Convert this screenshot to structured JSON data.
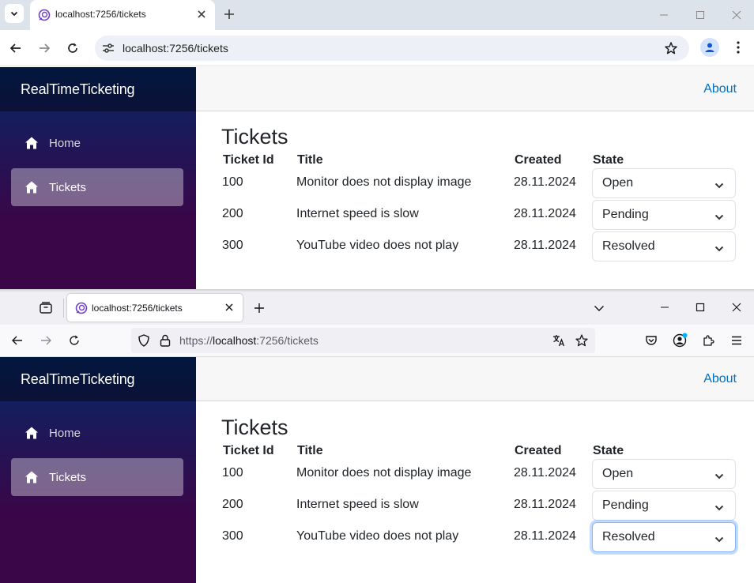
{
  "chrome": {
    "tab_title": "localhost:7256/tickets",
    "url": "localhost:7256/tickets"
  },
  "firefox": {
    "tab_title": "localhost:7256/tickets",
    "url_scheme": "https://",
    "url_host": "localhost",
    "url_rest": ":7256/tickets"
  },
  "app": {
    "brand": "RealTimeTicketing",
    "nav": [
      {
        "label": "Home",
        "icon": "home-icon",
        "active": false
      },
      {
        "label": "Tickets",
        "icon": "home-icon",
        "active": true
      }
    ],
    "about_label": "About",
    "heading": "Tickets",
    "columns": [
      "Ticket Id",
      "Title",
      "Created",
      "State"
    ],
    "tickets": [
      {
        "id": "100",
        "title": "Monitor does not display image",
        "created": "28.11.2024",
        "state": "Open"
      },
      {
        "id": "200",
        "title": "Internet speed is slow",
        "created": "28.11.2024",
        "state": "Pending"
      },
      {
        "id": "300",
        "title": "YouTube video does not play",
        "created": "28.11.2024",
        "state": "Resolved"
      }
    ]
  },
  "colors": {
    "sidebar_top": "#052767",
    "sidebar_bottom": "#3a0647",
    "link": "#0071c1",
    "focus_ring": "#86b7fe"
  }
}
